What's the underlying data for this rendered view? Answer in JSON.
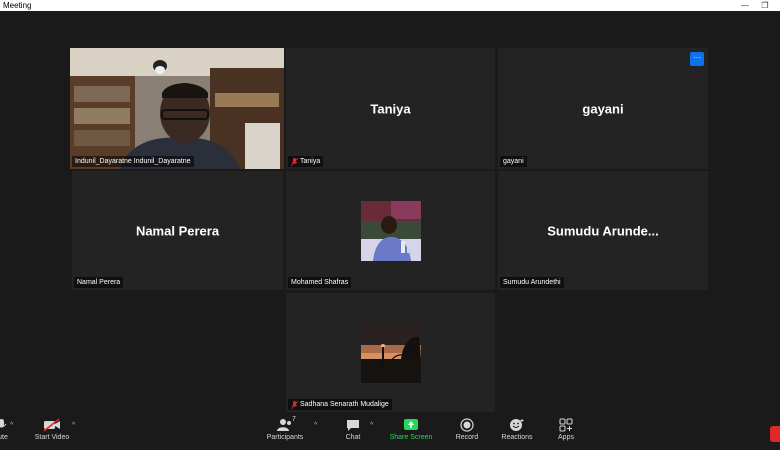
{
  "window": {
    "title": "Meeting"
  },
  "participants": [
    {
      "display_name": "Indunil_Dayaratne Indunil_Dayaratne",
      "big_label": "",
      "muted": false,
      "has_video": true
    },
    {
      "display_name": "Taniya",
      "big_label": "Taniya",
      "muted": true,
      "has_video": false
    },
    {
      "display_name": "gayani",
      "big_label": "gayani",
      "muted": false,
      "has_video": false
    },
    {
      "display_name": "Namal Perera",
      "big_label": "Namal Perera",
      "muted": false,
      "has_video": false
    },
    {
      "display_name": "Mohamed Shafras",
      "big_label": "",
      "muted": false,
      "has_video": false
    },
    {
      "display_name": "Sumudu Arundethi",
      "big_label": "Sumudu  Arunde...",
      "muted": false,
      "has_video": false
    },
    {
      "display_name": "Sadhana Senarath Mudalige",
      "big_label": "",
      "muted": true,
      "has_video": false
    }
  ],
  "toolbar": {
    "mute_label": "ute",
    "start_video_label": "Start Video",
    "participants_label": "Participants",
    "participants_count": "7",
    "chat_label": "Chat",
    "share_label": "Share Screen",
    "record_label": "Record",
    "reactions_label": "Reactions",
    "apps_label": "Apps"
  },
  "colors": {
    "active_speaker_border": "#c8e65a",
    "share_green": "#23d959",
    "more_blue": "#0e72ed",
    "mute_red": "#e02828"
  }
}
